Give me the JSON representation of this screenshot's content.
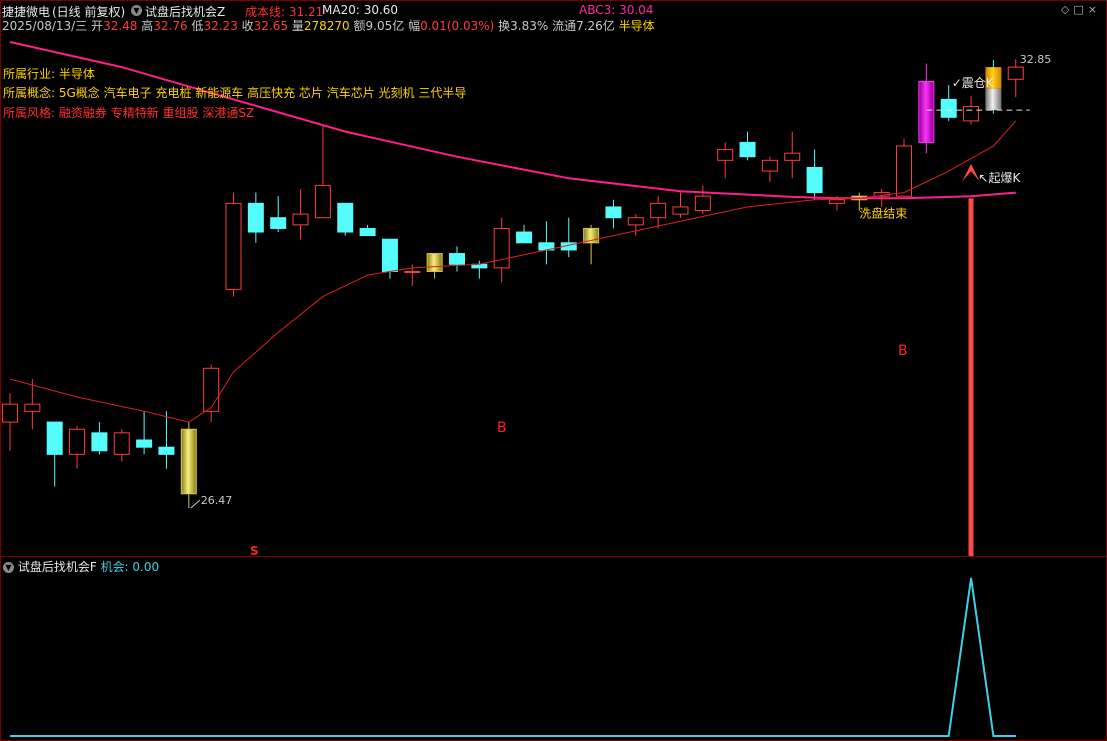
{
  "header": {
    "stock": "捷捷微电",
    "period": "(日线 前复权)",
    "indicator": "试盘后找机会Z",
    "cost_label": "成本线: 31.21",
    "ma20_label": "MA20: 30.60",
    "abc_label": "ABC3: 30.04",
    "controls": [
      "◇",
      "□",
      "×"
    ]
  },
  "quote": {
    "date": "2025/08/13/三",
    "open_label": "开",
    "open": "32.48",
    "high_label": "高",
    "high": "32.76",
    "low_label": "低",
    "low": "32.23",
    "close_label": "收",
    "close": "32.65",
    "vol_label": "量",
    "vol": "278270",
    "amount": "额9.05亿",
    "amp_label": "幅",
    "amp": "0.01(0.03%)",
    "turnover": "换3.83%",
    "float": "流通7.26亿",
    "sector": "半导体"
  },
  "info": {
    "industry_label": "所属行业:",
    "industry": "半导体",
    "concept_label": "所属概念:",
    "concept": "5G概念 汽车电子 充电桩 新能源车 高压快充 芯片 汽车芯片 光刻机 三代半导",
    "style_label": "所属风格:",
    "style": "融资融券 专精特新 重组股 深港通SZ"
  },
  "annotations": {
    "high": "32.85",
    "low": "26.47",
    "zhencang": "✓震仓K",
    "qibao": "↖起爆K",
    "xipan": "洗盘结束",
    "b1": "B",
    "b2": "B",
    "s": "S"
  },
  "sub_panel": {
    "title": "试盘后找机会F",
    "value_label": "机会: 0.00"
  },
  "colors": {
    "up": "#ff3c3c",
    "down": "#54fcfc",
    "ma_long": "#ff1e8c",
    "ma_short": "#e02020",
    "signal_purple": "#dd00dd",
    "signal_gold": "#f7c600",
    "sub_line": "#3fd0e8"
  },
  "chart_data": {
    "type": "candlestick",
    "price_range": [
      26.0,
      33.0
    ],
    "candles": [
      {
        "o": 27.7,
        "h": 28.1,
        "l": 27.3,
        "c": 27.95
      },
      {
        "o": 27.85,
        "h": 28.3,
        "l": 27.6,
        "c": 27.95
      },
      {
        "o": 27.7,
        "h": 27.7,
        "l": 26.8,
        "c": 27.25
      },
      {
        "o": 27.25,
        "h": 27.65,
        "l": 27.05,
        "c": 27.6
      },
      {
        "o": 27.55,
        "h": 27.7,
        "l": 27.25,
        "c": 27.3
      },
      {
        "o": 27.25,
        "h": 27.6,
        "l": 27.15,
        "c": 27.55
      },
      {
        "o": 27.45,
        "h": 27.85,
        "l": 27.25,
        "c": 27.35
      },
      {
        "o": 27.35,
        "h": 27.85,
        "l": 27.05,
        "c": 27.25
      },
      {
        "o": 26.7,
        "h": 27.7,
        "l": 26.5,
        "c": 27.6,
        "mark": "gold"
      },
      {
        "o": 27.85,
        "h": 28.5,
        "l": 27.7,
        "c": 28.45
      },
      {
        "o": 29.55,
        "h": 30.9,
        "l": 29.45,
        "c": 30.75
      },
      {
        "o": 30.75,
        "h": 30.9,
        "l": 30.2,
        "c": 30.35
      },
      {
        "o": 30.55,
        "h": 30.85,
        "l": 30.35,
        "c": 30.4
      },
      {
        "o": 30.45,
        "h": 30.95,
        "l": 30.25,
        "c": 30.6
      },
      {
        "o": 30.55,
        "h": 31.85,
        "l": 30.55,
        "c": 31.0
      },
      {
        "o": 30.75,
        "h": 30.75,
        "l": 30.3,
        "c": 30.35
      },
      {
        "o": 30.4,
        "h": 30.45,
        "l": 30.3,
        "c": 30.3
      },
      {
        "o": 30.25,
        "h": 30.25,
        "l": 29.7,
        "c": 29.8
      },
      {
        "o": 29.8,
        "h": 29.9,
        "l": 29.6,
        "c": 29.8
      },
      {
        "o": 29.8,
        "h": 30.05,
        "l": 29.7,
        "c": 30.05,
        "mark": "gold"
      },
      {
        "o": 30.05,
        "h": 30.15,
        "l": 29.8,
        "c": 29.9
      },
      {
        "o": 29.9,
        "h": 29.95,
        "l": 29.7,
        "c": 29.85
      },
      {
        "o": 29.85,
        "h": 30.55,
        "l": 29.65,
        "c": 30.4
      },
      {
        "o": 30.35,
        "h": 30.45,
        "l": 30.2,
        "c": 30.2
      },
      {
        "o": 30.2,
        "h": 30.5,
        "l": 29.9,
        "c": 30.1
      },
      {
        "o": 30.2,
        "h": 30.55,
        "l": 30.0,
        "c": 30.1
      },
      {
        "o": 30.2,
        "h": 30.45,
        "l": 29.9,
        "c": 30.4,
        "mark": "gold"
      },
      {
        "o": 30.7,
        "h": 30.8,
        "l": 30.4,
        "c": 30.55
      },
      {
        "o": 30.45,
        "h": 30.6,
        "l": 30.3,
        "c": 30.55
      },
      {
        "o": 30.55,
        "h": 30.85,
        "l": 30.4,
        "c": 30.75
      },
      {
        "o": 30.6,
        "h": 30.9,
        "l": 30.55,
        "c": 30.7
      },
      {
        "o": 30.65,
        "h": 31.0,
        "l": 30.6,
        "c": 30.85
      },
      {
        "o": 31.35,
        "h": 31.6,
        "l": 31.1,
        "c": 31.5
      },
      {
        "o": 31.6,
        "h": 31.75,
        "l": 31.35,
        "c": 31.4
      },
      {
        "o": 31.2,
        "h": 31.4,
        "l": 31.05,
        "c": 31.35
      },
      {
        "o": 31.35,
        "h": 31.75,
        "l": 31.1,
        "c": 31.45
      },
      {
        "o": 31.25,
        "h": 31.5,
        "l": 30.8,
        "c": 30.9
      },
      {
        "o": 30.75,
        "h": 30.85,
        "l": 30.65,
        "c": 30.8
      },
      {
        "o": 30.8,
        "h": 30.9,
        "l": 30.65,
        "c": 30.85,
        "mark": "gold"
      },
      {
        "o": 30.85,
        "h": 30.95,
        "l": 30.7,
        "c": 30.9
      },
      {
        "o": 30.85,
        "h": 31.65,
        "l": 30.85,
        "c": 31.55
      },
      {
        "o": 31.6,
        "h": 32.7,
        "l": 31.45,
        "c": 32.45,
        "mark": "purple"
      },
      {
        "o": 32.2,
        "h": 32.4,
        "l": 31.9,
        "c": 31.95
      },
      {
        "o": 31.9,
        "h": 32.25,
        "l": 31.85,
        "c": 32.1
      },
      {
        "o": 32.65,
        "h": 32.75,
        "l": 32.0,
        "c": 32.05,
        "mark": "goldsilver"
      },
      {
        "o": 32.48,
        "h": 32.76,
        "l": 32.23,
        "c": 32.65
      }
    ],
    "ma_long": [
      [
        0,
        33.0
      ],
      [
        5,
        32.65
      ],
      [
        10,
        32.2
      ],
      [
        15,
        31.75
      ],
      [
        20,
        31.4
      ],
      [
        25,
        31.1
      ],
      [
        30,
        30.92
      ],
      [
        35,
        30.84
      ],
      [
        37,
        30.82
      ],
      [
        40,
        30.82
      ],
      [
        43,
        30.85
      ],
      [
        45,
        30.9
      ]
    ],
    "ma_short": [
      [
        0,
        28.3
      ],
      [
        3,
        28.05
      ],
      [
        6,
        27.85
      ],
      [
        8,
        27.7
      ],
      [
        9,
        27.9
      ],
      [
        10,
        28.4
      ],
      [
        12,
        28.95
      ],
      [
        14,
        29.45
      ],
      [
        16,
        29.75
      ],
      [
        18,
        29.85
      ],
      [
        21,
        29.9
      ],
      [
        24,
        30.1
      ],
      [
        27,
        30.3
      ],
      [
        30,
        30.5
      ],
      [
        33,
        30.7
      ],
      [
        36,
        30.8
      ],
      [
        38,
        30.82
      ],
      [
        40,
        30.9
      ],
      [
        42,
        31.2
      ],
      [
        44,
        31.55
      ],
      [
        45,
        31.9
      ]
    ],
    "opportunity": [
      [
        0,
        0
      ],
      [
        41,
        0
      ],
      [
        42,
        0
      ],
      [
        43,
        1.0
      ],
      [
        44,
        0
      ],
      [
        45,
        0
      ]
    ]
  }
}
